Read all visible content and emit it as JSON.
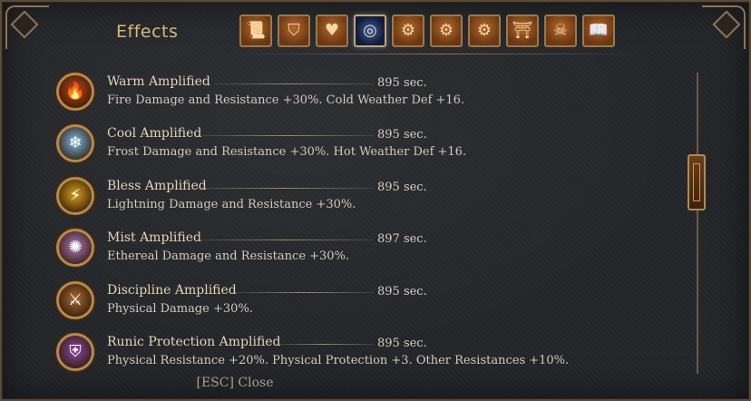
{
  "window": {
    "title": "Effects",
    "close_hint": "[ESC] Close"
  },
  "tabs": [
    {
      "icon": "scroll-icon",
      "glyph": "📜",
      "active": false
    },
    {
      "icon": "shield-icon",
      "glyph": "⛉",
      "active": false
    },
    {
      "icon": "broken-heart-icon",
      "glyph": "♥",
      "active": false
    },
    {
      "icon": "vortex-icon",
      "glyph": "◎",
      "active": true
    },
    {
      "icon": "gear-shield-icon",
      "glyph": "⚙",
      "active": false
    },
    {
      "icon": "gear-hammer-icon",
      "glyph": "⚙",
      "active": false
    },
    {
      "icon": "gear-wrench-icon",
      "glyph": "⚙",
      "active": false
    },
    {
      "icon": "gate-icon",
      "glyph": "⛩",
      "active": false
    },
    {
      "icon": "skull-icon",
      "glyph": "☠",
      "active": false
    },
    {
      "icon": "book-icon",
      "glyph": "📖",
      "active": false
    }
  ],
  "effects": [
    {
      "name": "Warm Amplified",
      "time": "895 sec.",
      "description": "Fire Damage and Resistance +30%. Cold Weather Def +16.",
      "icon": "fire-icon",
      "glyph": "🔥",
      "color": "#c2471c"
    },
    {
      "name": "Cool Amplified",
      "time": "895 sec.",
      "description": "Frost Damage and Resistance +30%. Hot Weather Def +16.",
      "icon": "frost-icon",
      "glyph": "❄",
      "color": "#7fb8e0"
    },
    {
      "name": "Bless Amplified",
      "time": "895 sec.",
      "description": "Lightning Damage and Resistance +30%.",
      "icon": "lightning-icon",
      "glyph": "⚡",
      "color": "#d9a020"
    },
    {
      "name": "Mist Amplified",
      "time": "897 sec.",
      "description": "Ethereal Damage and Resistance +30%.",
      "icon": "ethereal-icon",
      "glyph": "✺",
      "color": "#b07ab8"
    },
    {
      "name": "Discipline Amplified",
      "time": "895 sec.",
      "description": "Physical Damage +30%.",
      "icon": "crossed-axes-icon",
      "glyph": "⚔",
      "color": "#a86a34"
    },
    {
      "name": "Runic Protection Amplified",
      "time": "895 sec.",
      "description": "Physical Resistance +20%. Physical Protection +3. Other Resistances +10%.",
      "icon": "runic-shield-icon",
      "glyph": "⛨",
      "color": "#8c4a9e"
    }
  ]
}
